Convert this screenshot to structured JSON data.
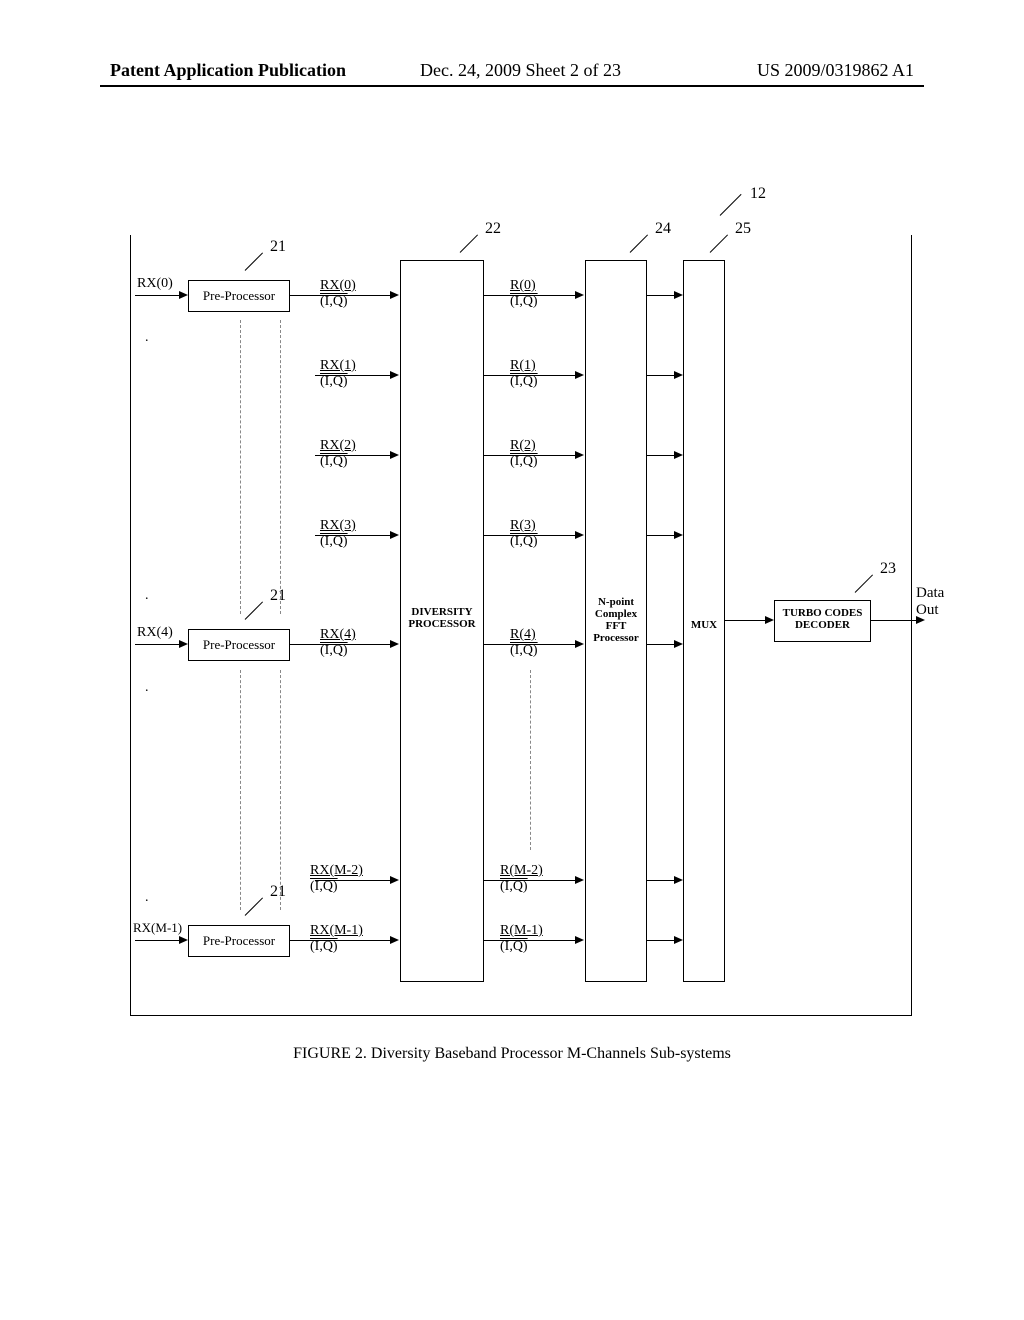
{
  "header": {
    "left": "Patent Application Publication",
    "mid": "Dec. 24, 2009  Sheet 2 of 23",
    "right": "US 2009/0319862 A1"
  },
  "refs": {
    "r12": "12",
    "r21a": "21",
    "r21b": "21",
    "r21c": "21",
    "r22": "22",
    "r23": "23",
    "r24": "24",
    "r25": "25"
  },
  "inputs": {
    "rx0": "RX(0)",
    "rx4": "RX(4)",
    "rxm1": "RX(M-1)"
  },
  "preproc": {
    "label": "Pre-Processor",
    "out0_top": "RX(0)",
    "out0_bot": "(I,Q)",
    "out1_top": "RX(1)",
    "out1_bot": "(I,Q)",
    "out2_top": "RX(2)",
    "out2_bot": "(I,Q)",
    "out3_top": "RX(3)",
    "out3_bot": "(I,Q)",
    "out4_top": "RX(4)",
    "out4_bot": "(I,Q)",
    "outm2_top": "RX(M-2)",
    "outm2_bot": "(I,Q)",
    "outm1_top": "RX(M-1)",
    "outm1_bot": "(I,Q)"
  },
  "diversity": {
    "label1": "DIVERSITY",
    "label2": "PROCESSOR",
    "r0_top": "R(0)",
    "r0_bot": "(I,Q)",
    "r1_top": "R(1)",
    "r1_bot": "(I,Q)",
    "r2_top": "R(2)",
    "r2_bot": "(I,Q)",
    "r3_top": "R(3)",
    "r3_bot": "(I,Q)",
    "r4_top": "R(4)",
    "r4_bot": "(I,Q)",
    "rm2_top": "R(M-2)",
    "rm2_bot": "(I,Q)",
    "rm1_top": "R(M-1)",
    "rm1_bot": "(I,Q)"
  },
  "fft": {
    "l1": "N-point",
    "l2": "Complex",
    "l3": "FFT",
    "l4": "Processor"
  },
  "mux": {
    "label": "MUX"
  },
  "decoder": {
    "l1": "TURBO CODES",
    "l2": "DECODER"
  },
  "output": {
    "l1": "Data",
    "l2": "Out"
  },
  "caption": "FIGURE 2.  Diversity Baseband Processor M-Channels Sub-systems"
}
